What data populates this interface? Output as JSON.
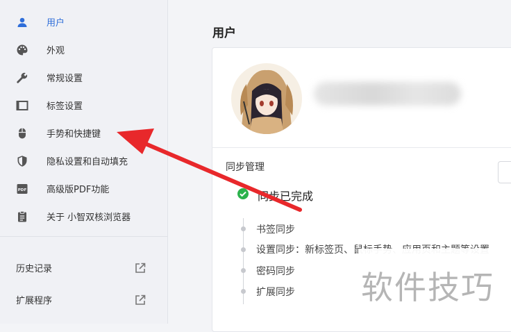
{
  "nav": {
    "items": [
      {
        "label": "用户",
        "icon": "user-icon"
      },
      {
        "label": "外观",
        "icon": "palette-icon"
      },
      {
        "label": "常规设置",
        "icon": "wrench-icon"
      },
      {
        "label": "标签设置",
        "icon": "tab-icon"
      },
      {
        "label": "手势和快捷键",
        "icon": "mouse-icon"
      },
      {
        "label": "隐私设置和自动填充",
        "icon": "shield-icon"
      },
      {
        "label": "高级版PDF功能",
        "icon": "pdf-icon"
      },
      {
        "label": "关于 小智双核浏览器",
        "icon": "clipboard-icon"
      }
    ],
    "external": [
      {
        "label": "历史记录",
        "icon": "external-link-icon"
      },
      {
        "label": "扩展程序",
        "icon": "external-link-icon"
      }
    ]
  },
  "main": {
    "title": "用户",
    "sync": {
      "heading": "同步管理",
      "status": "同步已完成",
      "items": [
        "书签同步",
        "设置同步：新标签页、鼠标手势、应用页和主题等设置",
        "密码同步",
        "扩展同步"
      ]
    }
  },
  "watermark": "软件技巧",
  "colors": {
    "accent": "#2f6ed9",
    "success": "#2bb24c",
    "arrow": "#e8282b"
  }
}
